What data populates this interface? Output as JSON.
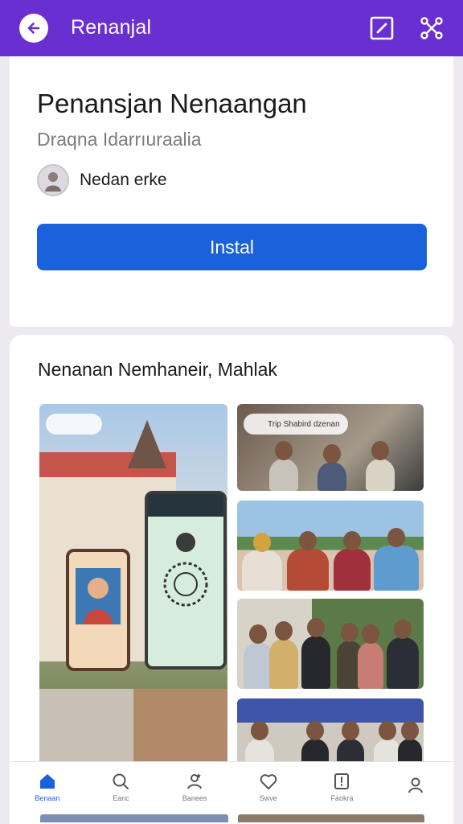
{
  "appbar": {
    "title": "Renanjal",
    "back_icon": "arrow-left-icon",
    "edit_icon": "edit-icon",
    "share_icon": "share-network-icon",
    "color": "#6a2fd0"
  },
  "app": {
    "name": "Penansjan Nenaangan",
    "subtitle": "Draqna Idarrıuraalia",
    "developer": "Nedan erke",
    "install_label": "Instal",
    "install_color": "#1a62db"
  },
  "screenshots": {
    "section_title": "Nenanan Nemhaneir, Mahlak",
    "items": [
      {
        "caption": ""
      },
      {
        "caption": "Trip Shabird dzenan"
      },
      {
        "caption": ""
      },
      {
        "caption": ""
      },
      {
        "caption": ""
      }
    ]
  },
  "bottom_nav": {
    "items": [
      {
        "label": "Benaan",
        "icon": "home-icon"
      },
      {
        "label": "Eanc",
        "icon": "search-icon"
      },
      {
        "label": "Banees",
        "icon": "profile-star-icon"
      },
      {
        "label": "Swve",
        "icon": "heart-icon"
      },
      {
        "label": "Faokra",
        "icon": "alert-box-icon"
      },
      {
        "label": "",
        "icon": "person-icon"
      }
    ]
  }
}
